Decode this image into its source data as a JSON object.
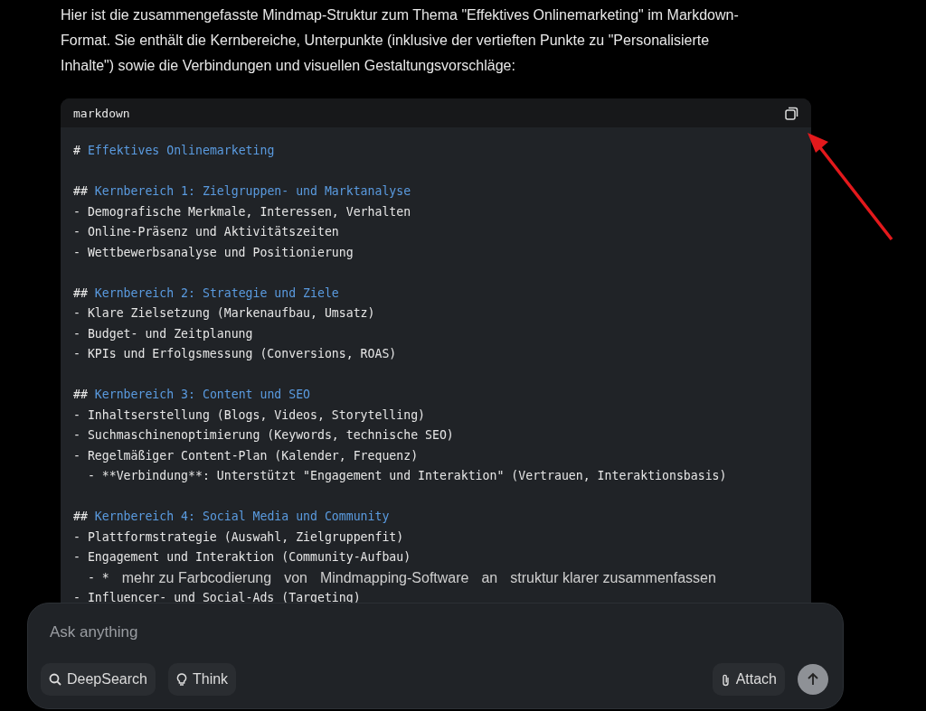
{
  "intro": "Hier ist die zusammengefasste Mindmap-Struktur zum Thema \"Effektives Onlinemarketing\" im Markdown-Format. Sie enthält die Kernbereiche, Unterpunkte (inklusive der vertieften Punkte zu \"Personalisierte Inhalte\") sowie die Verbindungen und visuellen Gestaltungsvorschläge:",
  "code_block": {
    "language": "markdown",
    "lines": [
      {
        "kind": "heading",
        "marker": "#",
        "text": "Effektives Onlinemarketing"
      },
      {
        "kind": "blank"
      },
      {
        "kind": "heading",
        "marker": "##",
        "text": "Kernbereich 1: Zielgruppen- und Marktanalyse"
      },
      {
        "kind": "text",
        "text": "- Demografische Merkmale, Interessen, Verhalten"
      },
      {
        "kind": "text",
        "text": "- Online-Präsenz und Aktivitätszeiten"
      },
      {
        "kind": "text",
        "text": "- Wettbewerbsanalyse und Positionierung"
      },
      {
        "kind": "blank"
      },
      {
        "kind": "heading",
        "marker": "##",
        "text": "Kernbereich 2: Strategie und Ziele"
      },
      {
        "kind": "text",
        "text": "- Klare Zielsetzung (Markenaufbau, Umsatz)"
      },
      {
        "kind": "text",
        "text": "- Budget- und Zeitplanung"
      },
      {
        "kind": "text",
        "text": "- KPIs und Erfolgsmessung (Conversions, ROAS)"
      },
      {
        "kind": "blank"
      },
      {
        "kind": "heading",
        "marker": "##",
        "text": "Kernbereich 3: Content und SEO"
      },
      {
        "kind": "text",
        "text": "- Inhaltserstellung (Blogs, Videos, Storytelling)"
      },
      {
        "kind": "text",
        "text": "- Suchmaschinenoptimierung (Keywords, technische SEO)"
      },
      {
        "kind": "text",
        "text": "- Regelmäßiger Content-Plan (Kalender, Frequenz)"
      },
      {
        "kind": "text",
        "text": "  - **Verbindung**: Unterstützt \"Engagement und Interaktion\" (Vertrauen, Interaktionsbasis)"
      },
      {
        "kind": "blank"
      },
      {
        "kind": "heading",
        "marker": "##",
        "text": "Kernbereich 4: Social Media und Community"
      },
      {
        "kind": "text",
        "text": "- Plattformstrategie (Auswahl, Zielgruppenfit)"
      },
      {
        "kind": "text",
        "text": "- Engagement und Interaktion (Community-Aufbau)"
      },
      {
        "kind": "suggestions",
        "prefix": "  - *",
        "chips": [
          "mehr zu Farbcodierung",
          "von",
          "Mindmapping-Software",
          "an",
          "struktur klarer zusammenfassen"
        ]
      },
      {
        "kind": "text",
        "text": "- Influencer- und Social-Ads (Targeting)"
      }
    ]
  },
  "composer": {
    "placeholder": "Ask anything",
    "left_buttons": [
      {
        "kind": "search",
        "label": "DeepSearch"
      },
      {
        "kind": "bulb",
        "label": "Think"
      }
    ],
    "attach": "Attach"
  }
}
